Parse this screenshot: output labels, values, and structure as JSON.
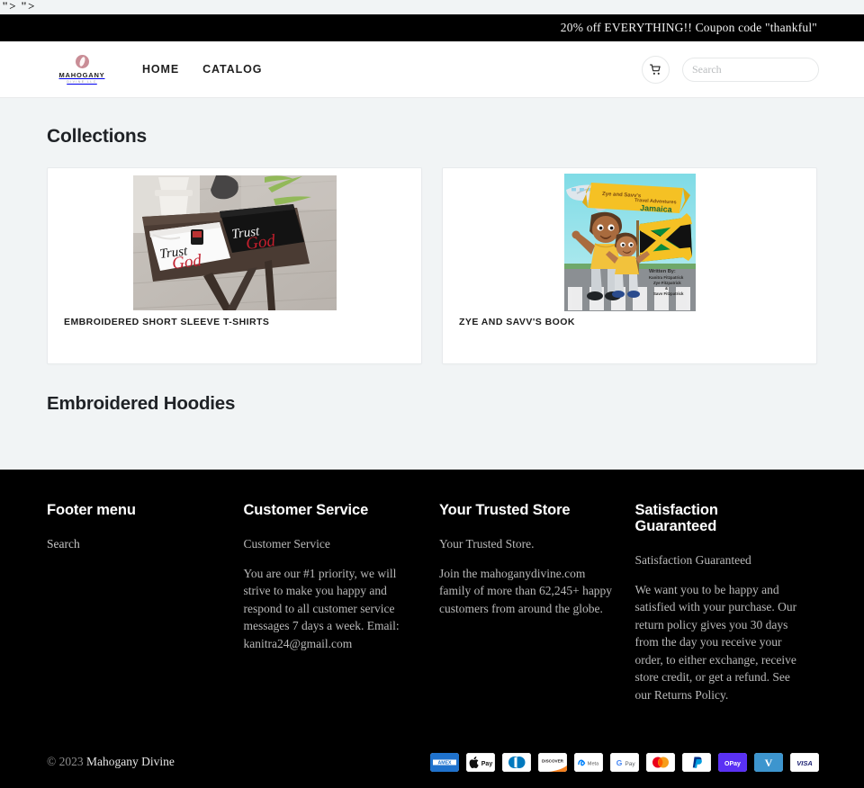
{
  "artifact_text": "\"> \">",
  "announcement": {
    "text": "20% off EVERYTHING!! Coupon code \"thankful\""
  },
  "header": {
    "logo": {
      "name": "MAHOGANY",
      "sub": "DIVINE LLC",
      "icon": "mahogany-leaf-emblem"
    },
    "nav": [
      {
        "label": "HOME",
        "name": "nav-home"
      },
      {
        "label": "CATALOG",
        "name": "nav-catalog"
      }
    ],
    "cart_icon": "shopping-cart-icon",
    "search": {
      "placeholder": "Search",
      "value": "",
      "icon": "search-icon"
    }
  },
  "main": {
    "collections_title": "Collections",
    "hoodies_title": "Embroidered Hoodies",
    "cards": [
      {
        "title": "EMBROIDERED SHORT SLEEVE T-SHIRTS",
        "image_alt": "Two folded Trust God embroidered t-shirts, white and black, on a wooden table"
      },
      {
        "title": "ZYE AND SAVV'S BOOK",
        "image_alt": "Zye and Savv's Travel Adventures Jamaica children's book cover"
      }
    ]
  },
  "book_cover": {
    "banner_line1": "Zye and Savv's",
    "banner_line2": "Travel Adventures",
    "banner_line3": "Jamaica",
    "credit_line1": "Written By:",
    "credit_line2": "Kanitra Fitzpatrick",
    "credit_line3": "Zye Fitzpatrick",
    "credit_line4": "&",
    "credit_line5": "Savv Fitzpatrick"
  },
  "tshirt_art": {
    "white_top": "Trust",
    "white_bottom": "God",
    "black_top": "Trust",
    "black_bottom": "God"
  },
  "footer": {
    "columns": [
      {
        "heading": "Footer menu",
        "links": [
          {
            "label": "Search",
            "name": "footer-link-search"
          }
        ],
        "paragraphs": []
      },
      {
        "heading": "Customer Service",
        "links": [],
        "paragraphs": [
          "Customer Service",
          "You are our #1 priority, we will strive to make you happy and respond to all customer service messages 7 days a week. Email: kanitra24@gmail.com"
        ]
      },
      {
        "heading": "Your Trusted Store",
        "links": [],
        "paragraphs": [
          "Your Trusted Store.",
          "Join the mahoganydivine.com family of more than 62,245+ happy customers from around the globe."
        ]
      },
      {
        "heading": "Satisfaction Guaranteed",
        "links": [],
        "paragraphs": [
          "Satisfaction Guaranteed",
          "We want you to be happy and satisfied with your purchase. Our return policy gives you 30 days from the day you receive your order, to either exchange, receive store credit, or get a refund. See our Returns Policy."
        ]
      }
    ],
    "copyright_symbol": "© 2023 ",
    "copyright_store": "Mahogany Divine",
    "payments": [
      {
        "name": "amex",
        "label": "AMEX"
      },
      {
        "name": "apple-pay",
        "label": "Pay"
      },
      {
        "name": "diners-club",
        "label": ""
      },
      {
        "name": "discover",
        "label": "DISCOVER"
      },
      {
        "name": "meta-pay",
        "label": "Meta"
      },
      {
        "name": "google-pay",
        "label": "Pay"
      },
      {
        "name": "mastercard",
        "label": ""
      },
      {
        "name": "paypal",
        "label": ""
      },
      {
        "name": "shop-pay",
        "label": "Pay"
      },
      {
        "name": "venmo",
        "label": "V"
      },
      {
        "name": "visa",
        "label": "VISA"
      }
    ]
  },
  "colors": {
    "page_bg": "#f1f4f5",
    "footer_bg": "#000000",
    "announce_bg": "#000000",
    "logo_accent": "#c98d96",
    "card_bg": "#ffffff"
  }
}
